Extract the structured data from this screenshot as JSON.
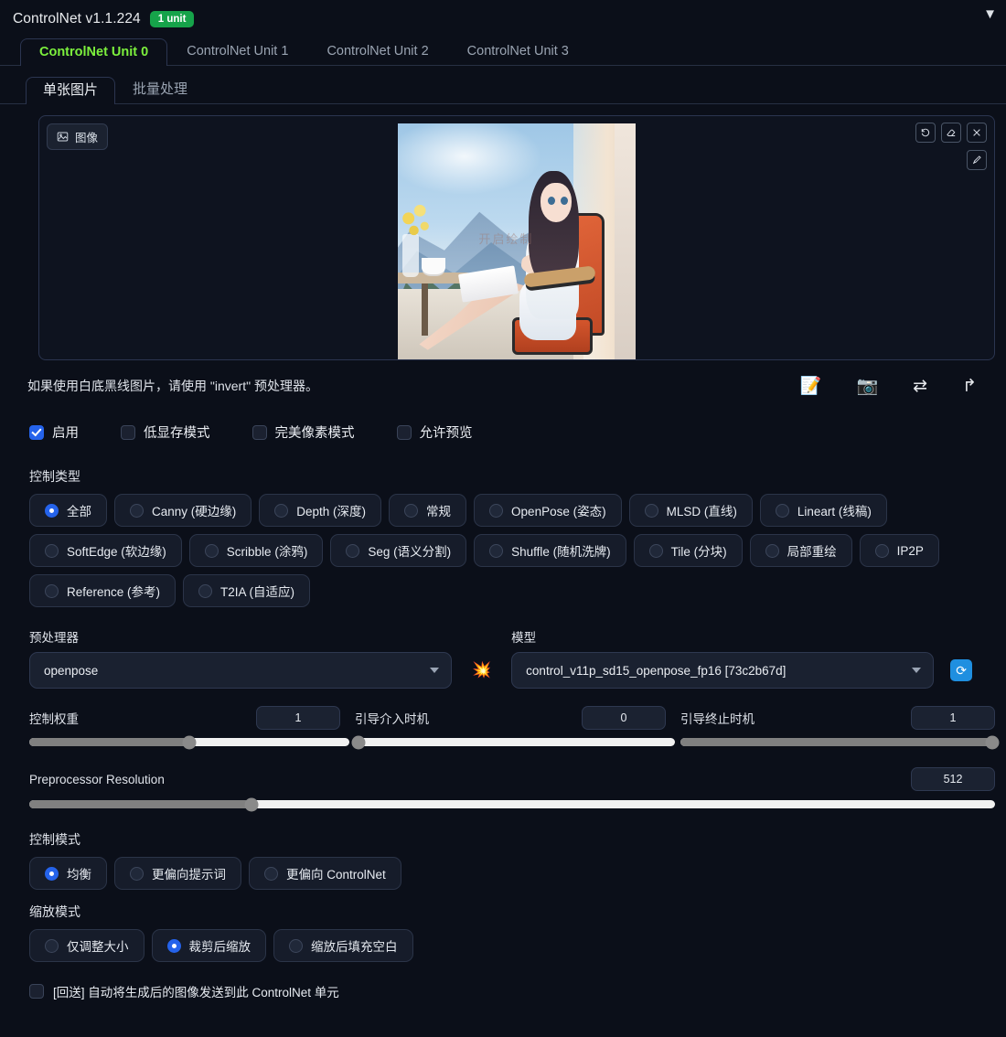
{
  "header": {
    "title": "ControlNet v1.1.224",
    "unit_badge": "1 unit",
    "collapse_icon": "▼",
    "badge_color": "#16a34a",
    "accent_color": "#7cf03d"
  },
  "unit_tabs": [
    {
      "label": "ControlNet Unit 0",
      "active": true
    },
    {
      "label": "ControlNet Unit 1",
      "active": false
    },
    {
      "label": "ControlNet Unit 2",
      "active": false
    },
    {
      "label": "ControlNet Unit 3",
      "active": false
    }
  ],
  "sub_tabs": [
    {
      "label": "单张图片",
      "active": true
    },
    {
      "label": "批量处理",
      "active": false
    }
  ],
  "image_panel": {
    "chip_label": "图像",
    "chip_icon": "image-icon",
    "tools": [
      {
        "name": "undo-icon",
        "glyph": "↺"
      },
      {
        "name": "eraser-icon",
        "glyph": "◌"
      },
      {
        "name": "close-icon",
        "glyph": "✕"
      }
    ],
    "tool_secondary": {
      "name": "brush-icon",
      "glyph": "✎"
    },
    "watermark": "开启绘制"
  },
  "hint": {
    "text": "如果使用白底黑线图片，请使用 \"invert\" 预处理器。",
    "icons": [
      {
        "name": "new-canvas-icon",
        "glyph": "📝"
      },
      {
        "name": "camera-icon",
        "glyph": "📷"
      },
      {
        "name": "swap-icon",
        "glyph": "⇄"
      },
      {
        "name": "send-icon",
        "glyph": "↱"
      }
    ]
  },
  "checkboxes": [
    {
      "label": "启用",
      "checked": true
    },
    {
      "label": "低显存模式",
      "checked": false
    },
    {
      "label": "完美像素模式",
      "checked": false
    },
    {
      "label": "允许预览",
      "checked": false
    }
  ],
  "control_type": {
    "label": "控制类型",
    "options": [
      {
        "label": "全部",
        "selected": true
      },
      {
        "label": "Canny (硬边缘)",
        "selected": false
      },
      {
        "label": "Depth (深度)",
        "selected": false
      },
      {
        "label": "常规",
        "selected": false
      },
      {
        "label": "OpenPose (姿态)",
        "selected": false
      },
      {
        "label": "MLSD (直线)",
        "selected": false
      },
      {
        "label": "Lineart (线稿)",
        "selected": false
      },
      {
        "label": "SoftEdge (软边缘)",
        "selected": false
      },
      {
        "label": "Scribble (涂鸦)",
        "selected": false
      },
      {
        "label": "Seg (语义分割)",
        "selected": false
      },
      {
        "label": "Shuffle (随机洗牌)",
        "selected": false
      },
      {
        "label": "Tile (分块)",
        "selected": false
      },
      {
        "label": "局部重绘",
        "selected": false
      },
      {
        "label": "IP2P",
        "selected": false
      },
      {
        "label": "Reference (参考)",
        "selected": false
      },
      {
        "label": "T2IA (自适应)",
        "selected": false
      }
    ]
  },
  "preprocessor": {
    "label": "预处理器",
    "value": "openpose"
  },
  "model": {
    "label": "模型",
    "value": "control_v11p_sd15_openpose_fp16 [73c2b67d]"
  },
  "mid_icon": {
    "name": "explosion-icon",
    "glyph": "💥"
  },
  "refresh_icon": {
    "name": "refresh-icon",
    "glyph": "⟳"
  },
  "sliders": [
    {
      "label": "控制权重",
      "value": "1",
      "fill_pct": 50
    },
    {
      "label": "引导介入时机",
      "value": "0",
      "fill_pct": 0
    },
    {
      "label": "引导终止时机",
      "value": "1",
      "fill_pct": 100
    },
    {
      "label": "Preprocessor Resolution",
      "value": "512",
      "fill_pct": 23
    }
  ],
  "control_mode": {
    "label": "控制模式",
    "options": [
      {
        "label": "均衡",
        "selected": true
      },
      {
        "label": "更偏向提示词",
        "selected": false
      },
      {
        "label": "更偏向 ControlNet",
        "selected": false
      }
    ]
  },
  "resize_mode": {
    "label": "缩放模式",
    "options": [
      {
        "label": "仅调整大小",
        "selected": false
      },
      {
        "label": "裁剪后缩放",
        "selected": true
      },
      {
        "label": "缩放后填充空白",
        "selected": false
      }
    ]
  },
  "loopback": {
    "label": "[回送] 自动将生成后的图像发送到此 ControlNet 单元",
    "checked": false
  }
}
